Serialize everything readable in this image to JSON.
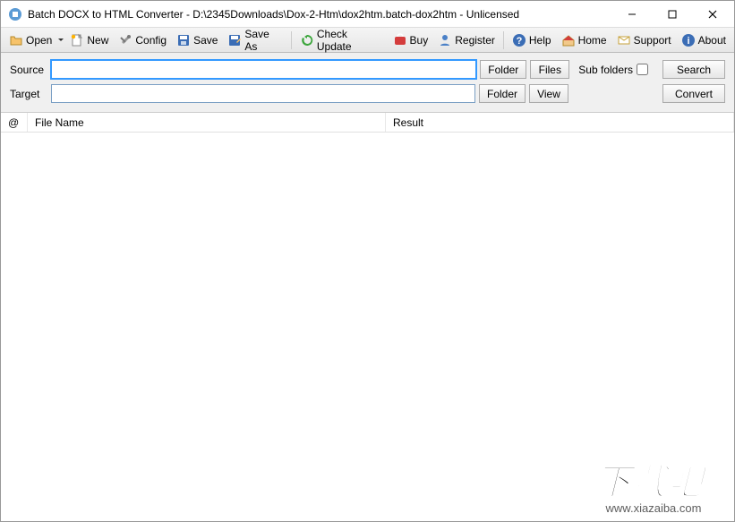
{
  "window": {
    "title": "Batch DOCX to HTML Converter - D:\\2345Downloads\\Dox-2-Htm\\dox2htm.batch-dox2htm - Unlicensed"
  },
  "toolbar": {
    "open": "Open",
    "new": "New",
    "config": "Config",
    "save": "Save",
    "save_as": "Save As",
    "check_update": "Check Update",
    "buy": "Buy",
    "register": "Register",
    "help": "Help",
    "home": "Home",
    "support": "Support",
    "about": "About"
  },
  "form": {
    "source_label": "Source",
    "source_value": "",
    "target_label": "Target",
    "target_value": "",
    "folder_btn": "Folder",
    "files_btn": "Files",
    "view_btn": "View",
    "sub_folders_label": "Sub folders",
    "sub_folders_checked": false,
    "search_btn": "Search",
    "convert_btn": "Convert"
  },
  "table": {
    "col_at": "@",
    "col_filename": "File Name",
    "col_result": "Result",
    "rows": []
  },
  "watermark": {
    "text": "下载吧",
    "url": "www.xiazaiba.com"
  }
}
